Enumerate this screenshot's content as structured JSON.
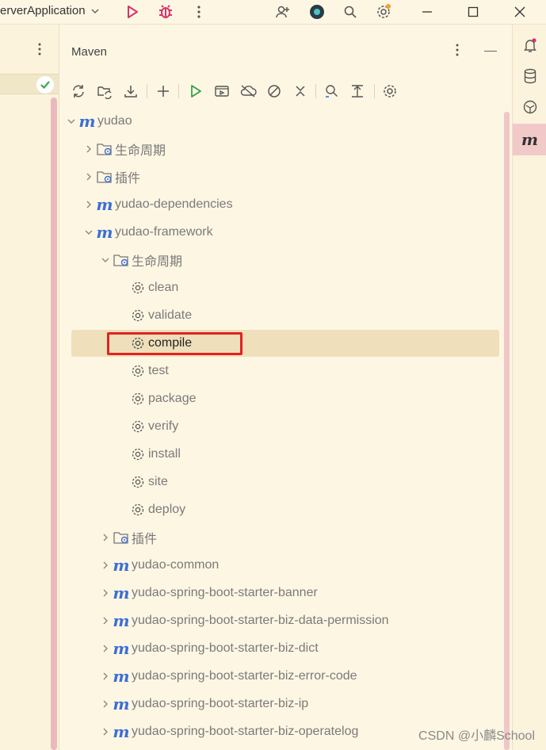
{
  "titlebar": {
    "run_config": "erverApplication",
    "icons": [
      "run-icon",
      "debug-icon",
      "more-icon",
      "add-user-icon",
      "ai-assistant-icon",
      "search-icon",
      "settings-icon",
      "minimize-icon",
      "maximize-icon",
      "close-icon"
    ]
  },
  "maven": {
    "title": "Maven",
    "toolbar": [
      "reload-icon",
      "reload-folder-icon",
      "download-icon",
      "add-icon",
      "run-icon",
      "execute-goal-icon",
      "offline-icon",
      "skip-tests-icon",
      "collapse-icon",
      "analyze-icon",
      "expand-icon",
      "settings-icon"
    ],
    "tree": {
      "root": "yudao",
      "lifecycle": "生命周期",
      "plugins": "插件",
      "dependencies_module": "yudao-dependencies",
      "framework_module": "yudao-framework",
      "goals": [
        "clean",
        "validate",
        "compile",
        "test",
        "package",
        "verify",
        "install",
        "site",
        "deploy"
      ],
      "selected_goal": "compile",
      "modules": [
        "yudao-common",
        "yudao-spring-boot-starter-banner",
        "yudao-spring-boot-starter-biz-data-permission",
        "yudao-spring-boot-starter-biz-dict",
        "yudao-spring-boot-starter-biz-error-code",
        "yudao-spring-boot-starter-biz-ip",
        "yudao-spring-boot-starter-biz-operatelog"
      ]
    }
  },
  "right_strip": [
    "notifications-icon",
    "database-icon",
    "ai-icon",
    "maven-icon"
  ],
  "watermark": "CSDN @小麟School",
  "colors": {
    "background": "#fdf6e3",
    "selection": "#efe0bb",
    "highlight_box": "#e32222",
    "maven_blue": "#3b6fd6"
  }
}
